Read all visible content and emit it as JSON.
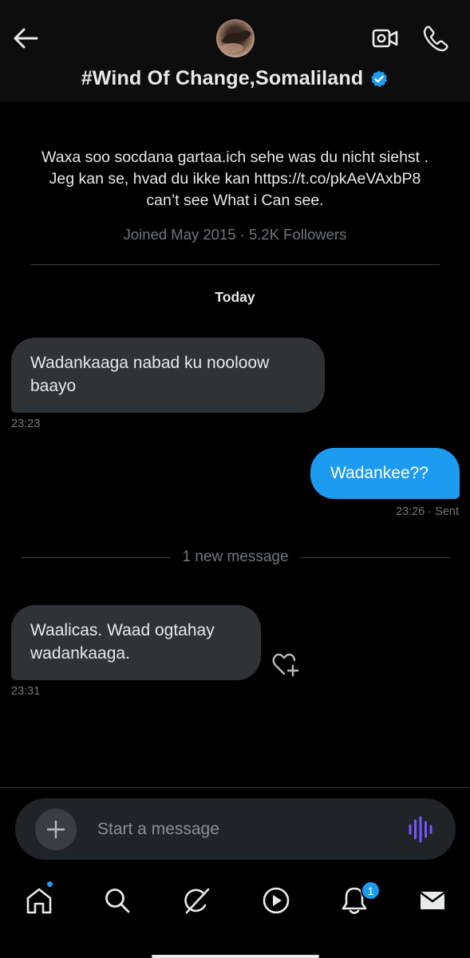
{
  "header": {
    "title": "#Wind Of Change,Somaliland",
    "back_icon": "arrow-left-icon",
    "video_icon": "video-camera-icon",
    "call_icon": "phone-icon",
    "verified_icon": "verified-badge-icon",
    "verified_color": "#1d9bf0"
  },
  "profile": {
    "bio": "Waxa soo socdana gartaa.ich sehe was du nicht siehst . Jeg kan se, hvad du ikke kan https://t.co/pkAeVAxbP8 can’t see What i Can see.",
    "joined": "Joined May 2015 · 5.2K Followers"
  },
  "conversation": {
    "date_label": "Today",
    "new_message_label": "1 new message",
    "messages": [
      {
        "direction": "in",
        "text": "Wadankaaga nabad ku nooloow baayo",
        "time": "23:23"
      },
      {
        "direction": "out",
        "text": "Wadankee??",
        "time": "23:26 · Sent"
      },
      {
        "direction": "in",
        "text": "Waalicas. Waad ogtahay wadankaaga.",
        "time": "23:31"
      }
    ]
  },
  "composer": {
    "placeholder": "Start a message",
    "add_icon": "plus-icon",
    "voice_icon": "voice-wave-icon",
    "voice_color": "#7856ff"
  },
  "tabbar": {
    "items": [
      "home-icon",
      "search-icon",
      "grok-icon",
      "play-icon",
      "bell-icon",
      "mail-icon"
    ],
    "notification_count": "1",
    "accent": "#1d9bf0"
  }
}
